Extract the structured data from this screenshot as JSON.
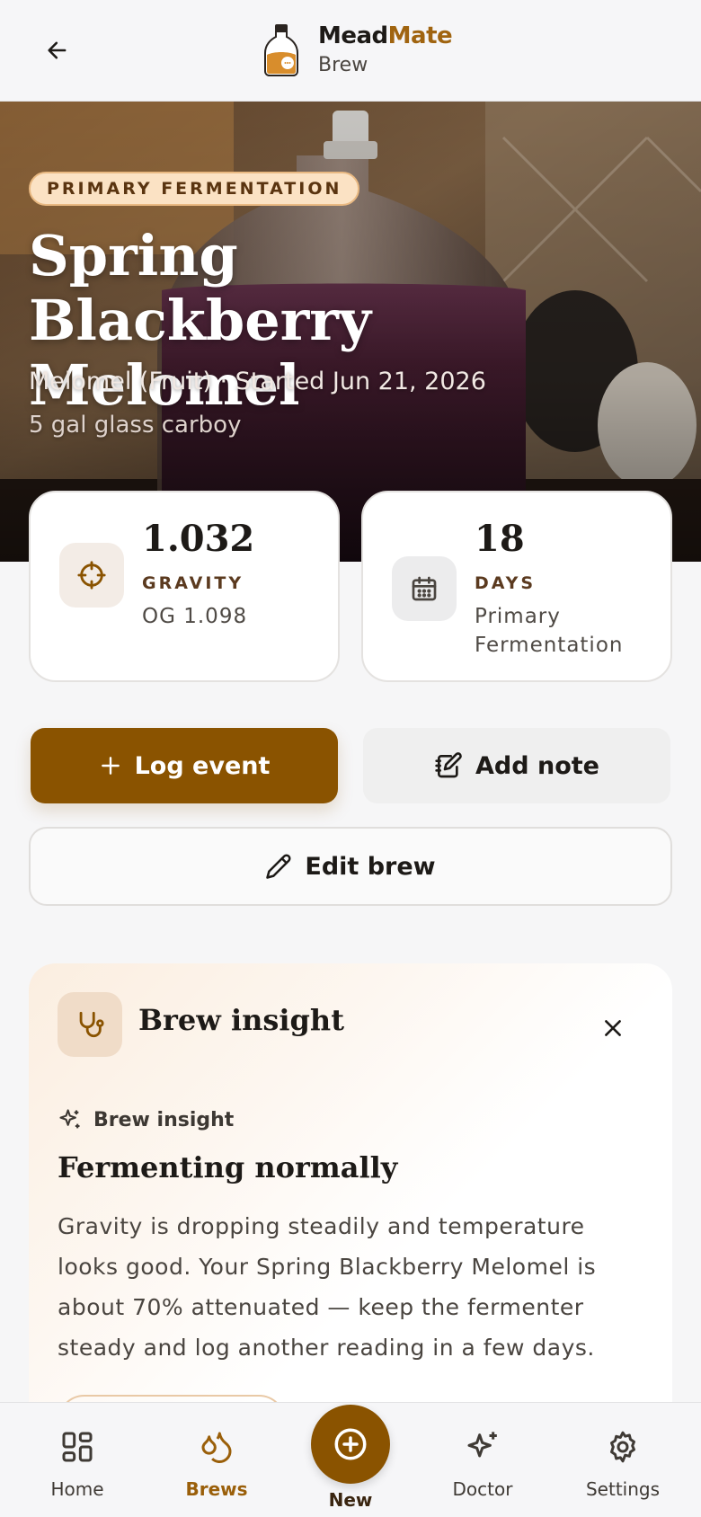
{
  "header": {
    "brand_part1": "Mead",
    "brand_part2": "Mate",
    "subtitle": "Brew"
  },
  "hero": {
    "phase_badge": "PRIMARY FERMENTATION",
    "title": "Spring Blackberry Melomel",
    "meta": "Melomel (Fruit) · Started Jun 21, 2026",
    "vessel": "5 gal glass carboy"
  },
  "stats": {
    "gravity": {
      "value": "1.032",
      "label": "GRAVITY",
      "sub": "OG 1.098",
      "icon": "target-icon"
    },
    "days": {
      "value": "18",
      "label": "DAYS",
      "sub": "Primary Fermentation",
      "icon": "calendar-icon"
    }
  },
  "actions": {
    "log_event": "Log event",
    "add_note": "Add note",
    "edit_brew": "Edit brew"
  },
  "insight": {
    "heading": "Brew insight",
    "tag": "Brew insight",
    "title": "Fermenting normally",
    "body": "Gravity is dropping steadily and temperature looks good. Your Spring Blackberry Melomel is about 70% attenuated — keep the fermenter steady and log another reading in a few days."
  },
  "nav": {
    "home": "Home",
    "brews": "Brews",
    "new": "New",
    "doctor": "Doctor",
    "settings": "Settings"
  },
  "colors": {
    "accent": "#8a5300",
    "accent_text": "#9a5f0a",
    "badge_bg": "#fbe2c4"
  }
}
